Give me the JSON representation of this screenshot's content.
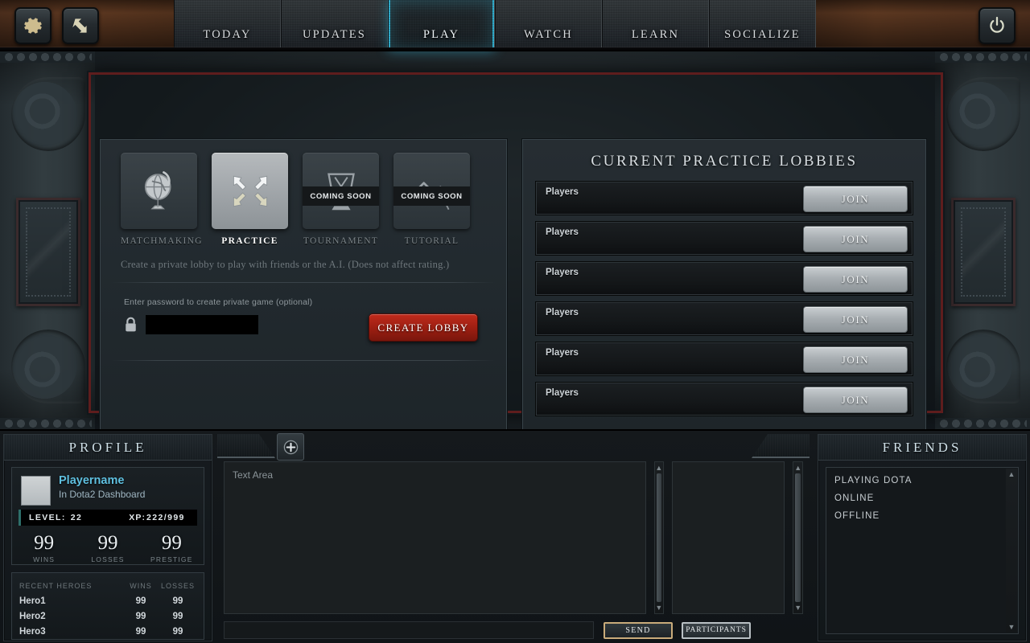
{
  "topbar": {
    "left_buttons": [
      {
        "name": "settings-button",
        "icon": "gear-icon"
      },
      {
        "name": "back-button",
        "icon": "back-arrow-icon"
      }
    ],
    "tabs": [
      {
        "label": "TODAY",
        "active": false
      },
      {
        "label": "UPDATES",
        "active": false
      },
      {
        "label": "PLAY",
        "active": true
      },
      {
        "label": "WATCH",
        "active": false
      },
      {
        "label": "LEARN",
        "active": false
      },
      {
        "label": "SOCIALIZE",
        "active": false
      }
    ],
    "right_button": {
      "name": "power-button",
      "icon": "power-icon"
    }
  },
  "play": {
    "modes": [
      {
        "label": "MATCHMAKING",
        "icon": "globe-icon",
        "selected": false,
        "coming_soon": null
      },
      {
        "label": "PRACTICE",
        "icon": "arrows-inward-icon",
        "selected": true,
        "coming_soon": null
      },
      {
        "label": "TOURNAMENT",
        "icon": "trophy-icon",
        "selected": false,
        "coming_soon": "COMING SOON"
      },
      {
        "label": "TUTORIAL",
        "icon": "mountain-icon",
        "selected": false,
        "coming_soon": "COMING SOON"
      }
    ],
    "description": "Create a private lobby to play with friends or the A.I.  (Does not affect rating.)",
    "password_label": "Enter password to create private game (optional)",
    "password_value": "",
    "password_placeholder": "",
    "create_lobby_label": "CREATE LOBBY"
  },
  "lobbies": {
    "title": "CURRENT PRACTICE LOBBIES",
    "join_label": "JOIN",
    "rows": [
      {
        "players": "Players"
      },
      {
        "players": "Players"
      },
      {
        "players": "Players"
      },
      {
        "players": "Players"
      },
      {
        "players": "Players"
      },
      {
        "players": "Players"
      }
    ]
  },
  "profile": {
    "title": "PROFILE",
    "playername": "Playername",
    "status": "In Dota2 Dashboard",
    "level_label": "LEVEL:",
    "level_value": "22",
    "xp_label": "XP:",
    "xp_value": "222/999",
    "stats": [
      {
        "num": "99",
        "cap": "WINS"
      },
      {
        "num": "99",
        "cap": "LOSSES"
      },
      {
        "num": "99",
        "cap": "PRESTIGE"
      }
    ],
    "heroes_header": {
      "name": "RECENT HEROES",
      "wins": "WINS",
      "losses": "LOSSES"
    },
    "heroes": [
      {
        "name": "Hero1",
        "wins": "99",
        "losses": "99"
      },
      {
        "name": "Hero2",
        "wins": "99",
        "losses": "99"
      },
      {
        "name": "Hero3",
        "wins": "99",
        "losses": "99"
      }
    ]
  },
  "chat": {
    "add_tab_icon": "plus-icon",
    "text_area_placeholder": "Text Area",
    "input_value": "",
    "send_label": "SEND",
    "participants_label": "PARTICIPANTS"
  },
  "friends": {
    "title": "FRIENDS",
    "groups": [
      "PLAYING DOTA",
      "ONLINE",
      "OFFLINE"
    ]
  },
  "colors": {
    "accent_cyan": "#3fc9e8",
    "create_lobby_red": "#9e1f12",
    "frame_red": "#5e1d1d",
    "player_name_blue": "#5fc0e0",
    "send_border_gold": "#c9ab7a"
  }
}
